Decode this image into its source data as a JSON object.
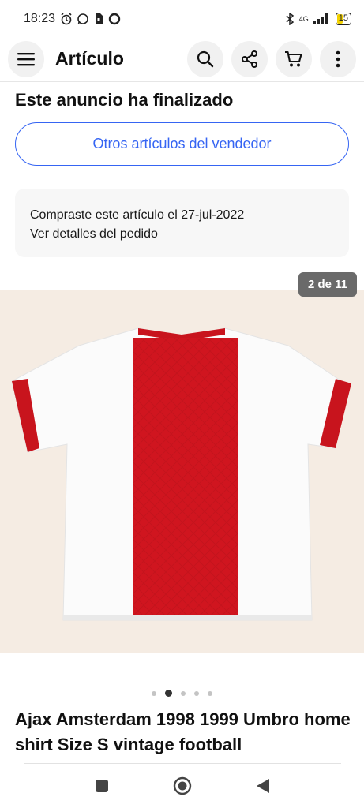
{
  "status_bar": {
    "time": "18:23",
    "network": "4G",
    "battery": "15"
  },
  "header": {
    "title": "Artículo",
    "menu_icon": "hamburger-menu-icon",
    "search_icon": "search-icon",
    "share_icon": "share-icon",
    "cart_icon": "cart-icon",
    "more_icon": "more-vertical-icon"
  },
  "listing": {
    "ended_text": "Este anuncio ha finalizado",
    "seller_button": "Otros artículos del vendedor",
    "purchased_text": "Compraste este artículo el 27-jul-2022",
    "order_link": "Ver detalles del pedido"
  },
  "gallery": {
    "counter": "2 de 11",
    "dots_total": 5,
    "dots_active_index": 1
  },
  "item": {
    "title": "Ajax Amsterdam 1998 1999 Umbro home shirt Size S vintage football"
  },
  "colors": {
    "accent": "#3665f3",
    "shirt_red": "#d0151f",
    "image_bg": "#f5ece3"
  }
}
